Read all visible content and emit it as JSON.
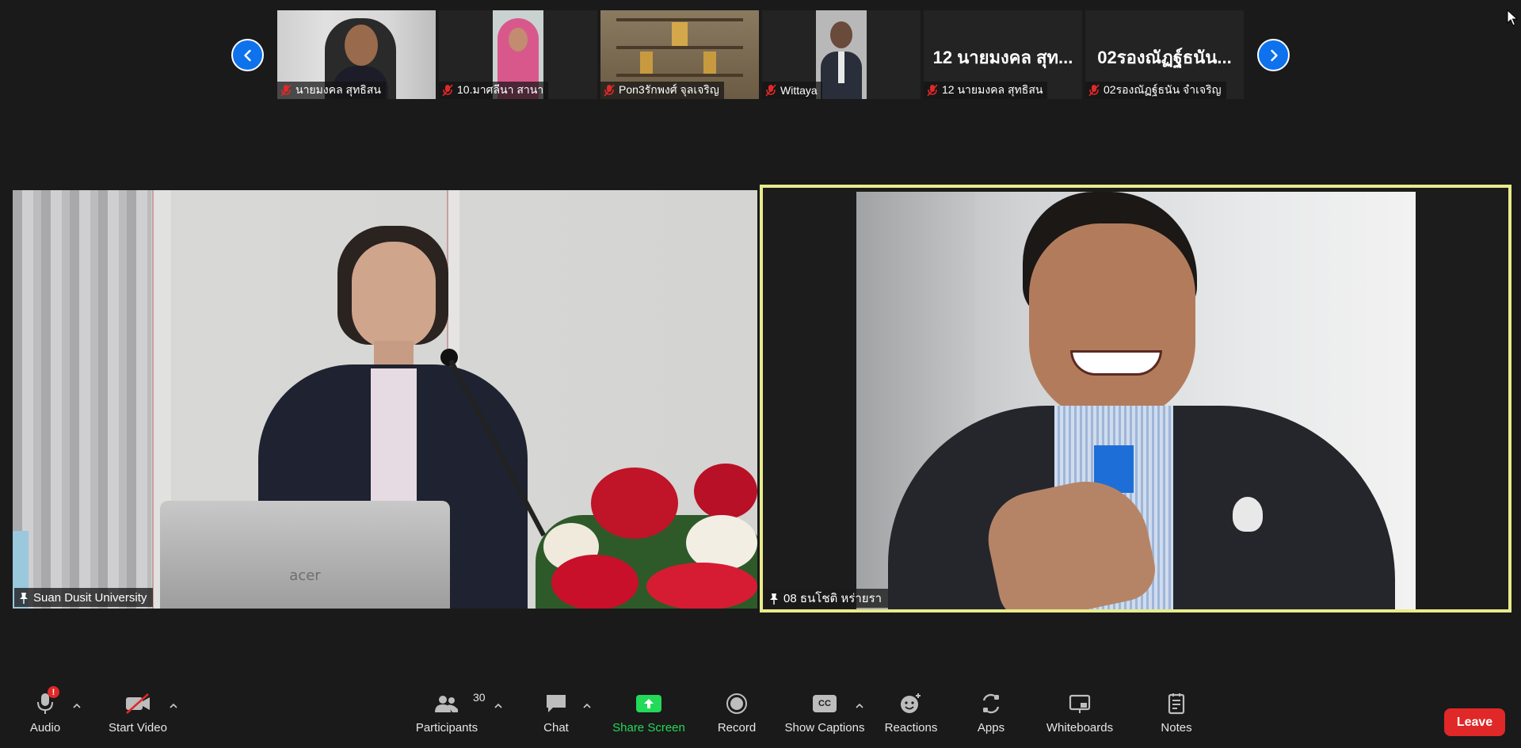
{
  "strip": {
    "prev_icon": "chevron-left-icon",
    "next_icon": "chevron-right-icon",
    "participants": [
      {
        "name": "นายมงคล สุทธิสน",
        "video": true,
        "muted": true
      },
      {
        "name": "10.มาศลีนา สานา",
        "video": true,
        "muted": true
      },
      {
        "name": "Pon3รักพงศ์ จุลเจริญ",
        "video": true,
        "muted": true
      },
      {
        "name": "Wittaya",
        "video": true,
        "muted": true
      },
      {
        "name": "12 นายมงคล สุทธิสน",
        "big_name": "12 นายมงคล สุท...",
        "video": false,
        "muted": true
      },
      {
        "name": "02รองณัฏฐ์ธนัน จำเจริญ",
        "big_name": "02รองณัฏฐ์ธนัน...",
        "video": false,
        "muted": true
      }
    ]
  },
  "main": {
    "left": {
      "name": "Suan Dusit University",
      "pinned": true,
      "laptop_brand": "acer"
    },
    "right": {
      "name": "08 ธนโชติ หร่ายรา",
      "pinned": true,
      "active_speaker": true
    }
  },
  "toolbar": {
    "audio": {
      "label": "Audio",
      "badge": "!"
    },
    "video": {
      "label": "Start Video"
    },
    "participants": {
      "label": "Participants",
      "count": "30"
    },
    "chat": {
      "label": "Chat"
    },
    "share": {
      "label": "Share Screen"
    },
    "record": {
      "label": "Record"
    },
    "captions": {
      "label": "Show Captions",
      "cc": "CC"
    },
    "reactions": {
      "label": "Reactions"
    },
    "apps": {
      "label": "Apps"
    },
    "whiteboards": {
      "label": "Whiteboards"
    },
    "notes": {
      "label": "Notes"
    },
    "leave": {
      "label": "Leave"
    }
  },
  "colors": {
    "background": "#1a1a1a",
    "active_speaker_border": "#e8ec8c",
    "nav_blue": "#0e72ed",
    "leave_red": "#e02828",
    "share_green": "#23d959"
  }
}
